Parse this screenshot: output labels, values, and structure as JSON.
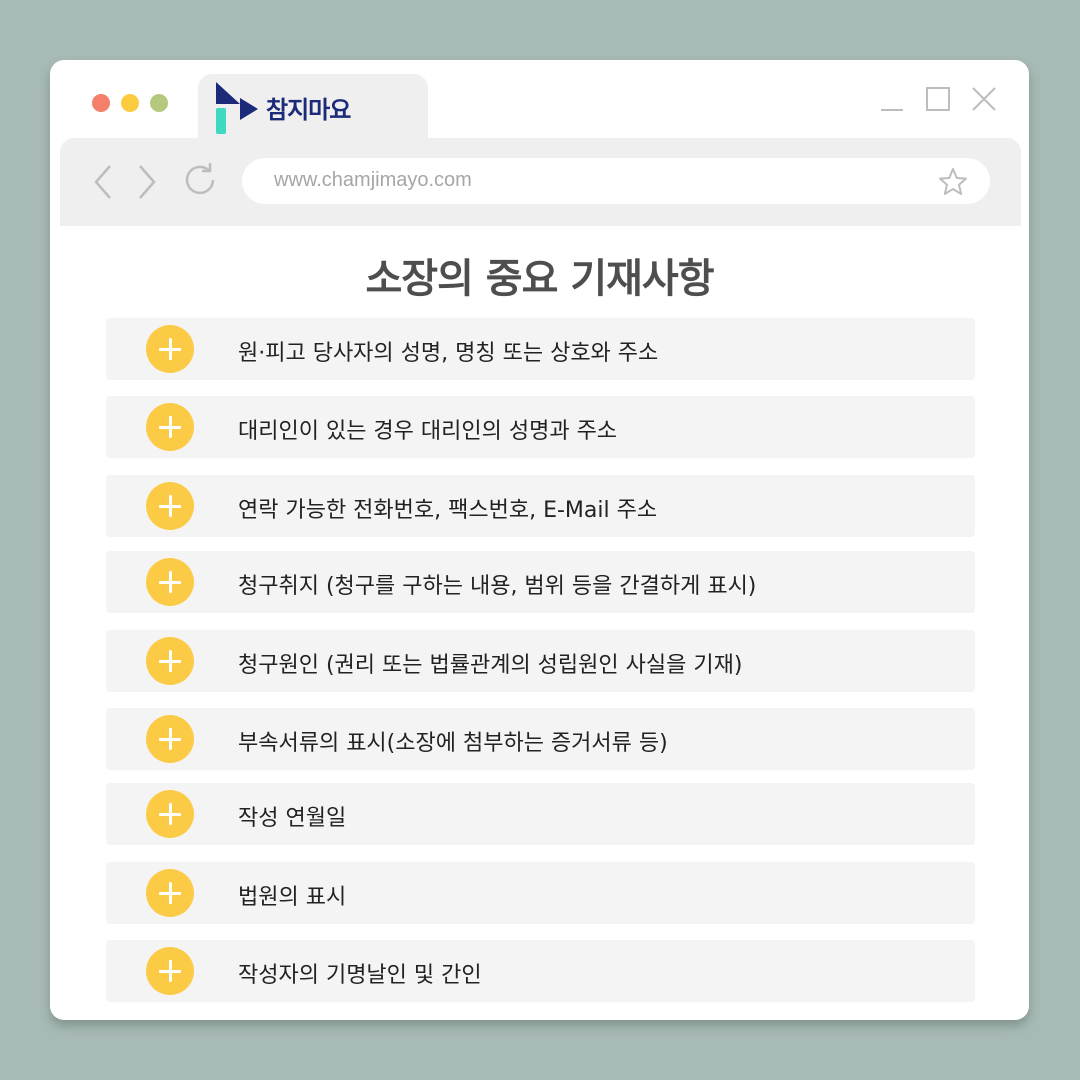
{
  "browser": {
    "tab_title": "참지마요",
    "url": "www.chamjimayo.com"
  },
  "page": {
    "title": "소장의 중요 기재사항"
  },
  "items": [
    {
      "label": "원·피고 당사자의 성명, 명칭 또는 상호와 주소"
    },
    {
      "label": "대리인이 있는 경우 대리인의 성명과 주소"
    },
    {
      "label": "연락 가능한 전화번호, 팩스번호, E-Mail 주소"
    },
    {
      "label": "청구취지 (청구를 구하는 내용, 범위 등을 간결하게 표시)"
    },
    {
      "label": "청구원인 (권리 또는 법률관계의 성립원인 사실을 기재)"
    },
    {
      "label": "부속서류의 표시(소장에 첨부하는 증거서류 등)"
    },
    {
      "label": "작성 연월일"
    },
    {
      "label": "법원의 표시"
    },
    {
      "label": "작성자의 기명날인 및 간인"
    }
  ],
  "colors": {
    "background": "#a8bab5",
    "accent": "#fccb45",
    "logo_navy": "#1c2a7a",
    "logo_mint": "#3fd9c0"
  },
  "icons": [
    "close-dot",
    "minimize-dot",
    "maximize-dot",
    "minimize-icon",
    "maximize-icon",
    "close-icon",
    "back-icon",
    "forward-icon",
    "refresh-icon",
    "star-icon",
    "plus-icon"
  ]
}
